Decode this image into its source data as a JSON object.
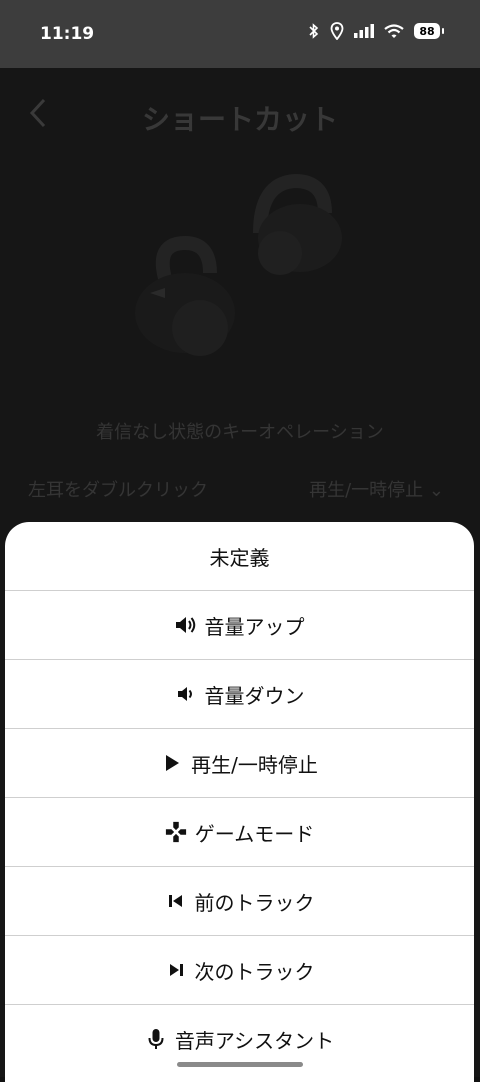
{
  "status_bar": {
    "time": "11:19",
    "battery": "88"
  },
  "page": {
    "back_glyph": "<",
    "title": "ショートカット",
    "caption": "着信なし状態のキーオペレーション",
    "row_label": "左耳をダブルクリック",
    "row_value": "再生/一時停止",
    "row_chevron": "⌄"
  },
  "sheet": {
    "options": [
      {
        "label": "未定義",
        "icon": null
      },
      {
        "label": "音量アップ",
        "icon": "volume-up-icon"
      },
      {
        "label": "音量ダウン",
        "icon": "volume-down-icon"
      },
      {
        "label": "再生/一時停止",
        "icon": "play-icon"
      },
      {
        "label": "ゲームモード",
        "icon": "gamepad-icon"
      },
      {
        "label": "前のトラック",
        "icon": "previous-track-icon"
      },
      {
        "label": "次のトラック",
        "icon": "next-track-icon"
      },
      {
        "label": "音声アシスタント",
        "icon": "microphone-icon"
      }
    ]
  },
  "colors": {
    "overlay": "#161616",
    "sheet": "#ffffff",
    "statusbar": "#3d3d3d"
  }
}
